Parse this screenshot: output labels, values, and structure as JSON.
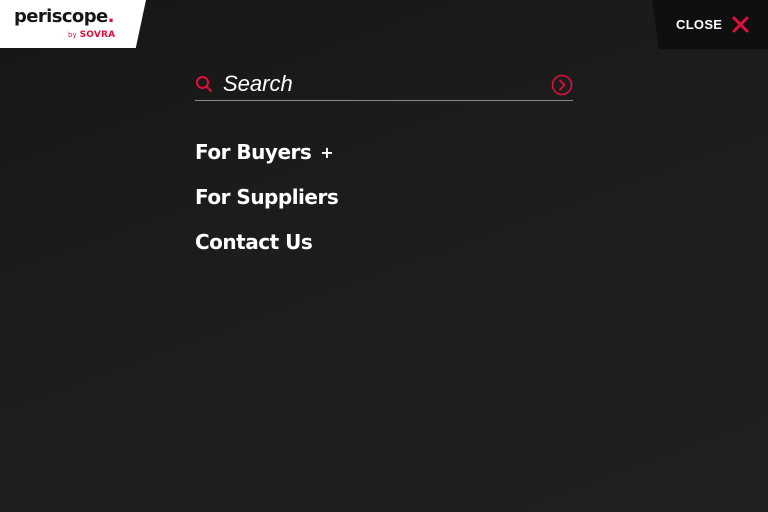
{
  "header": {
    "logo": {
      "name": "periscope",
      "dot": ".",
      "by": "by",
      "brand": "SOVRA"
    },
    "close": {
      "label": "CLOSE",
      "icon": "close-x-icon"
    }
  },
  "search": {
    "placeholder": "Search",
    "value": "",
    "search_icon": "search-icon",
    "submit_icon": "arrow-circle-right-icon"
  },
  "nav": {
    "items": [
      {
        "label": "For Buyers",
        "expand": "+"
      },
      {
        "label": "For Suppliers"
      },
      {
        "label": "Contact Us"
      }
    ]
  },
  "colors": {
    "background": "#1c1c1c",
    "accent": "#e0103b",
    "text": "#ffffff",
    "close_bg": "#0f0f0f"
  }
}
